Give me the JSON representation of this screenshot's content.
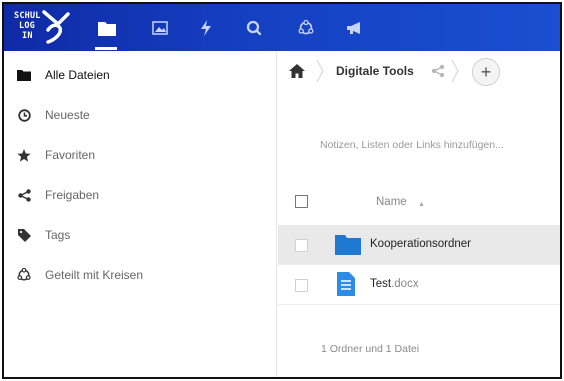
{
  "header": {
    "logo_lines": [
      "SCHUL",
      "LOG",
      "IN"
    ],
    "nav_icons": [
      "files-icon",
      "gallery-icon",
      "activity-icon",
      "search-icon",
      "circles-icon",
      "announcement-icon"
    ],
    "active_icon": "files-icon",
    "colors": {
      "header_start": "#0f2aa6",
      "header_end": "#1a4fd0"
    }
  },
  "sidebar": {
    "items": [
      {
        "label": "Alle Dateien",
        "icon": "folder-icon",
        "active": true
      },
      {
        "label": "Neueste",
        "icon": "clock-icon",
        "active": false
      },
      {
        "label": "Favoriten",
        "icon": "star-icon",
        "active": false
      },
      {
        "label": "Freigaben",
        "icon": "share-icon",
        "active": false
      },
      {
        "label": "Tags",
        "icon": "tag-icon",
        "active": false
      },
      {
        "label": "Geteilt mit Kreisen",
        "icon": "circles-icon",
        "active": false
      }
    ]
  },
  "breadcrumb": {
    "home_icon": "home-icon",
    "current": "Digitale Tools",
    "share_icon": "share-icon",
    "add_label": "+"
  },
  "notes_placeholder": "Notizen, Listen oder Links hinzufügen...",
  "table": {
    "name_header": "Name",
    "sort_indicator": "▲",
    "rows": [
      {
        "name": "Kooperationsordner",
        "ext": "",
        "type": "folder",
        "selected": true,
        "icon_color": "#1f78d1"
      },
      {
        "name": "Test",
        "ext": ".docx",
        "type": "document",
        "selected": false,
        "icon_color": "#2d8be8"
      }
    ],
    "summary": "1 Ordner und 1 Datei"
  }
}
